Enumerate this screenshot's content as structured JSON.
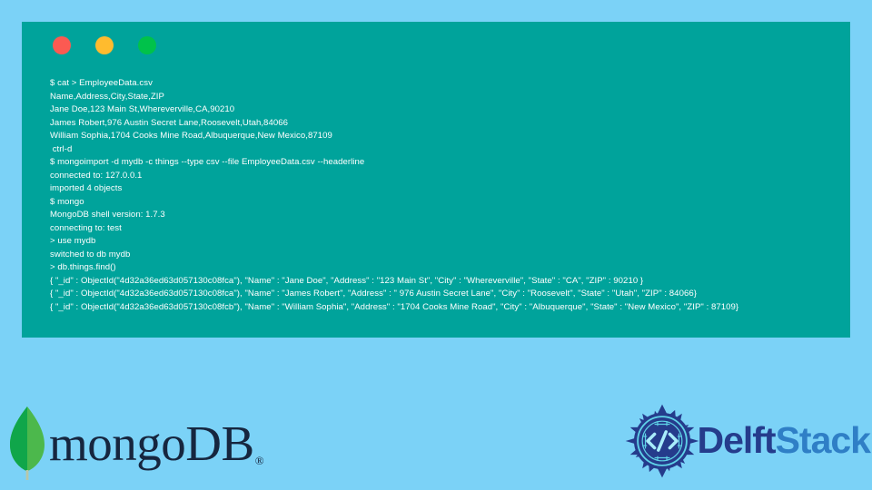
{
  "palette": {
    "page_background": "#7bd2f7",
    "terminal_background": "#00a39b",
    "terminal_text": "#ffffff",
    "traffic_close": "#fb5a52",
    "traffic_minimize": "#ffbb2e",
    "traffic_zoom": "#00c24a",
    "mongodb_leaf_dark": "#10a64a",
    "mongodb_leaf_light": "#4cb84c",
    "mongodb_wordmark": "#16263f",
    "delft_navy": "#253c8c",
    "stack_blue": "#2f7fc6"
  },
  "terminal": {
    "titlebar": {
      "close_label": "close",
      "minimize_label": "minimize",
      "zoom_label": "zoom"
    },
    "lines": [
      "$ cat > EmployeeData.csv",
      "Name,Address,City,State,ZIP",
      "Jane Doe,123 Main St,Whereverville,CA,90210",
      "James Robert,976 Austin Secret Lane,Roosevelt,Utah,84066",
      "William Sophia,1704 Cooks Mine Road,Albuquerque,New Mexico,87109",
      " ctrl-d",
      "$ mongoimport -d mydb -c things --type csv --file EmployeeData.csv --headerline",
      "connected to: 127.0.0.1",
      "imported 4 objects",
      "$ mongo",
      "MongoDB shell version: 1.7.3",
      "connecting to: test",
      "> use mydb",
      "switched to db mydb",
      "> db.things.find()",
      "{ \"_id\" : ObjectId(\"4d32a36ed63d057130c08fca\"), \"Name\" : \"Jane Doe\", \"Address\" : \"123 Main St\", \"City\" : \"Whereverville\", \"State\" : \"CA\", \"ZIP\" : 90210 }",
      "{ \"_id\" : ObjectId(\"4d32a36ed63d057130c08fca\"), \"Name\" : \"James Robert\", \"Address\" : \" 976 Austin Secret Lane\", \"City\" : \"Roosevelt\", \"State\" : \"Utah\", \"ZIP\" : 84066}",
      "{ \"_id\" : ObjectId(\"4d32a36ed63d057130c08fcb\"), \"Name\" : \"William Sophia\", \"Address\" : \"1704 Cooks Mine Road\", \"City\" : \"Albuquerque\", \"State\" : \"New Mexico\", \"ZIP\" : 87109}"
    ]
  },
  "mongodb_logo": {
    "leaf_icon_name": "mongodb-leaf",
    "wordmark_lower": "mongo",
    "wordmark_db": "DB",
    "registered_mark": "®"
  },
  "delftstack_logo": {
    "emblem_icon_name": "delftstack-code-mandala",
    "code_glyph": "</>",
    "wordmark_delft": "Delft",
    "wordmark_stack": "Stack"
  }
}
